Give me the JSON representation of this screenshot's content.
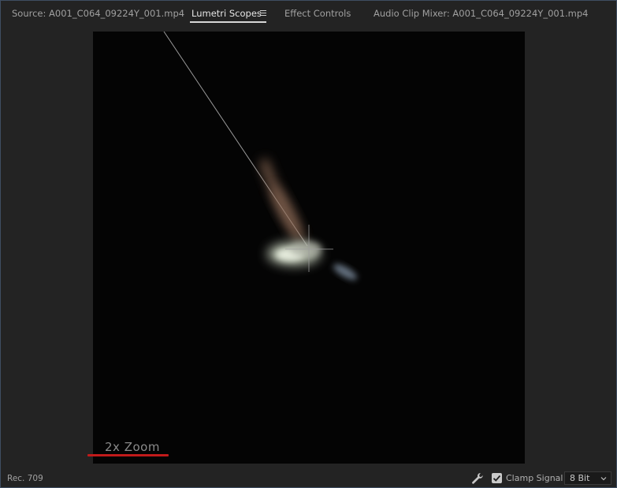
{
  "tabs": [
    {
      "label": "Source: A001_C064_09224Y_001.mp4",
      "active": false
    },
    {
      "label": "Lumetri Scopes",
      "active": true
    },
    {
      "label": "Effect Controls",
      "active": false
    },
    {
      "label": "Audio Clip Mixer: A001_C064_09224Y_001.mp4",
      "active": false
    }
  ],
  "scope": {
    "type": "vectorscope",
    "zoom_label": "2x Zoom",
    "annotation_color": "#c11a1a"
  },
  "status": {
    "color_space": "Rec. 709",
    "settings_icon": "wrench-icon",
    "clamp_signal_label": "Clamp Signal",
    "clamp_signal_checked": true,
    "bit_depth": "8 Bit"
  }
}
